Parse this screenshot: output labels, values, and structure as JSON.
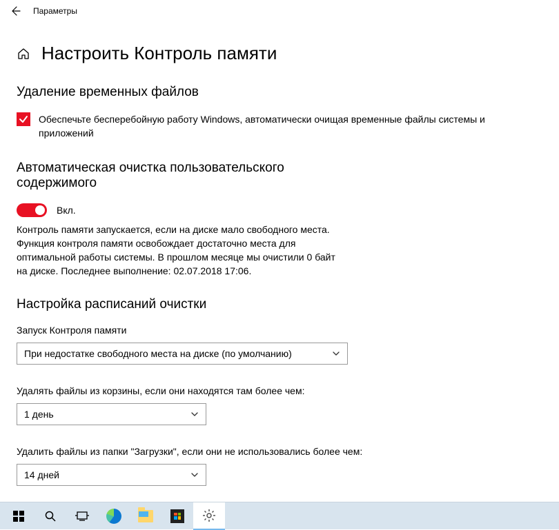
{
  "titlebar": {
    "label": "Параметры"
  },
  "page_title": "Настроить Контроль памяти",
  "section_temp": {
    "heading": "Удаление временных файлов",
    "checkbox_label": "Обеспечьте бесперебойную работу Windows, автоматически очищая временные файлы системы и приложений"
  },
  "section_auto": {
    "heading": "Автоматическая очистка пользовательского содержимого",
    "toggle_state": "Вкл.",
    "description": "Контроль памяти запускается, если на диске мало свободного места. Функция контроля памяти освобождает достаточно места для оптимальной работы системы. В прошлом месяце мы очистили 0 байт на диске. Последнее выполнение: 02.07.2018 17:06."
  },
  "section_schedule": {
    "heading": "Настройка расписаний очистки",
    "run_label": "Запуск Контроля памяти",
    "run_value": "При недостатке свободного места на диске (по умолчанию)",
    "recycle_label": "Удалять файлы из корзины, если они находятся там более чем:",
    "recycle_value": "1 день",
    "downloads_label": "Удалить файлы из папки \"Загрузки\", если они не использовались более чем:",
    "downloads_value": "14 дней"
  }
}
